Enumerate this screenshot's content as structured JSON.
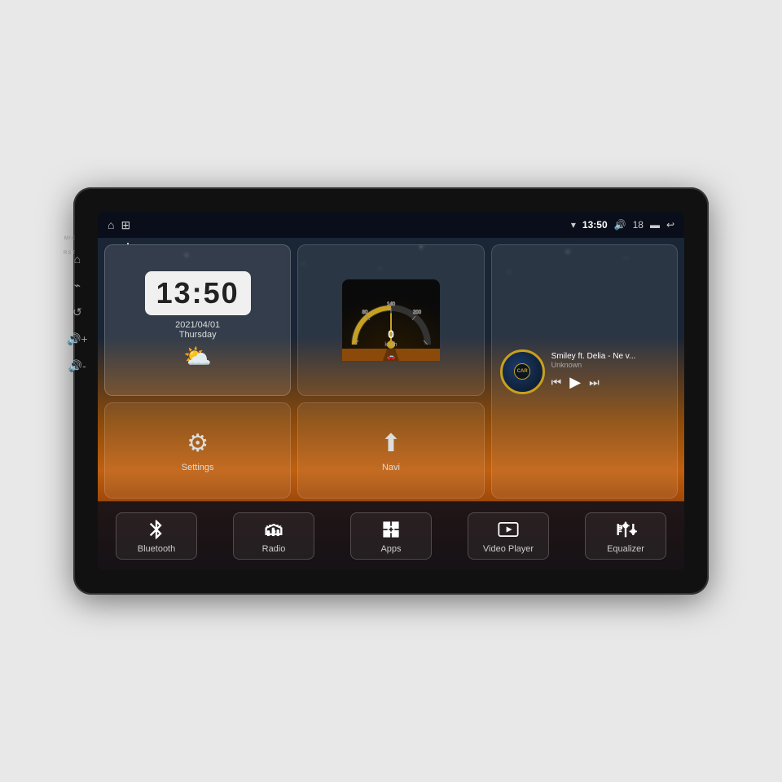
{
  "device": {
    "mic_label": "MIC",
    "rst_label": "RST"
  },
  "status_bar": {
    "wifi_icon": "▼",
    "time": "13:50",
    "volume_icon": "🔊",
    "volume_level": "18",
    "battery_icon": "▬",
    "back_icon": "↩",
    "home_icon": "⌂",
    "apps_icon": "⊞"
  },
  "clock": {
    "time": "13:50",
    "date": "2021/04/01",
    "day": "Thursday",
    "weather_icon": "⛅"
  },
  "speedometer": {
    "speed": "0",
    "unit": "km/h"
  },
  "music": {
    "title": "Smiley ft. Delia - Ne v...",
    "artist": "Unknown",
    "logo": "CARFU"
  },
  "widgets": {
    "settings_label": "Settings",
    "navi_label": "Navi"
  },
  "bottom_bar": [
    {
      "id": "bluetooth",
      "label": "Bluetooth",
      "icon": "bluetooth"
    },
    {
      "id": "radio",
      "label": "Radio",
      "icon": "radio"
    },
    {
      "id": "apps",
      "label": "Apps",
      "icon": "apps"
    },
    {
      "id": "video_player",
      "label": "Video Player",
      "icon": "video"
    },
    {
      "id": "equalizer",
      "label": "Equalizer",
      "icon": "eq"
    }
  ],
  "side_icons": [
    "⌂",
    "⌂",
    "↺",
    "📢+",
    "📢-"
  ]
}
